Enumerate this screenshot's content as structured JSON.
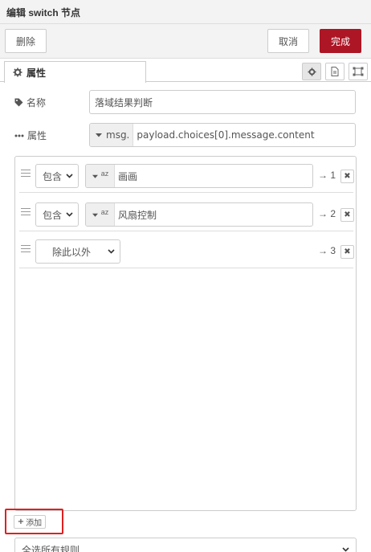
{
  "window": {
    "title": "编辑 switch 节点"
  },
  "toolbar": {
    "delete_label": "删除",
    "cancel_label": "取消",
    "done_label": "完成"
  },
  "tabs": {
    "properties_label": "属性"
  },
  "name_row": {
    "label": "名称",
    "value": "落域结果判断"
  },
  "property_row": {
    "label": "属性",
    "type": "msg.",
    "value": "payload.choices[0].message.content"
  },
  "rules": [
    {
      "operator": "包含",
      "value_type": "az",
      "value": "画画",
      "output": "→ 1"
    },
    {
      "operator": "包含",
      "value_type": "az",
      "value": "风扇控制",
      "output": "→ 2"
    },
    {
      "operator": "除此以外",
      "output": "→ 3"
    }
  ],
  "add_button": {
    "label": "添加"
  },
  "bottom_select": {
    "value": "全选所有规则"
  },
  "colors": {
    "primary": "#ad1625",
    "highlight": "#e02020"
  }
}
